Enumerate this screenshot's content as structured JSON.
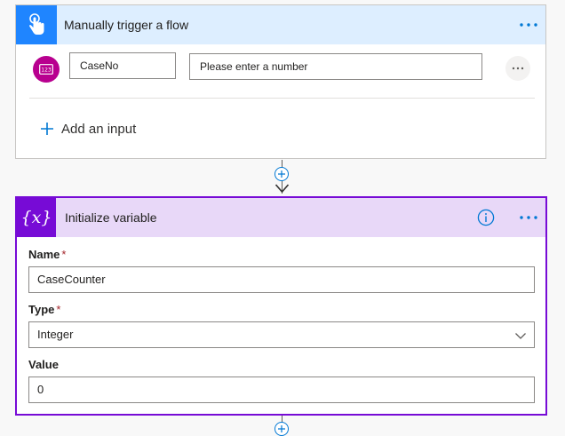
{
  "trigger": {
    "title": "Manually trigger a flow",
    "icon": "touch-hand-icon",
    "header_color": "#ddeeff",
    "icon_bg": "#1f85ff",
    "input": {
      "type_icon": "number-123-icon",
      "name_value": "CaseNo",
      "description_value": "Please enter a number"
    },
    "add_input_label": "Add an input"
  },
  "init_variable": {
    "title": "Initialize variable",
    "icon": "variable-braces-icon",
    "accent": "#770bd6",
    "header_color": "#e8d8f8",
    "name": {
      "label": "Name",
      "required_mark": "*",
      "value": "CaseCounter"
    },
    "type": {
      "label": "Type",
      "required_mark": "*",
      "value": "Integer"
    },
    "value": {
      "label": "Value",
      "value": "0"
    }
  }
}
